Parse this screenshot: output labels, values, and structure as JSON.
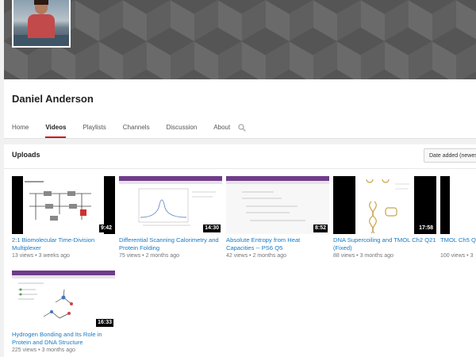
{
  "channel": {
    "name": "Daniel Anderson"
  },
  "tabs": [
    {
      "label": "Home"
    },
    {
      "label": "Videos"
    },
    {
      "label": "Playlists"
    },
    {
      "label": "Channels"
    },
    {
      "label": "Discussion"
    },
    {
      "label": "About"
    }
  ],
  "active_tab": "Videos",
  "uploads": {
    "title": "Uploads",
    "sort_label": "Date added (newest"
  },
  "videos": [
    {
      "title": "2:1 Biomolecular Time-Division Multiplexer",
      "duration": "9:42",
      "views": "13 views",
      "age": "3 weeks ago"
    },
    {
      "title": "Differential Scanning Calorimetry and Protein Folding",
      "duration": "14:30",
      "views": "75 views",
      "age": "2 months ago"
    },
    {
      "title": "Absolute Entropy from Heat Capacities -- PS6 Q5",
      "duration": "8:52",
      "views": "42 views",
      "age": "2 months ago"
    },
    {
      "title": "DNA Supercoiling and TMOL Ch2 Q21 (Fixed)",
      "duration": "17:58",
      "views": "88 views",
      "age": "3 months ago"
    },
    {
      "title": "TMOL Ch5 Q Problem",
      "duration": "",
      "views": "100 views",
      "age": "3"
    },
    {
      "title": "Hydrogen Bonding and Its Role in Protein and DNA Structure",
      "duration": "16:33",
      "views": "225 views",
      "age": "3 months ago"
    }
  ],
  "colors": {
    "accent_red": "#cc181e",
    "link_blue": "#167ac6",
    "slide_purple": "#6f3c8a"
  }
}
